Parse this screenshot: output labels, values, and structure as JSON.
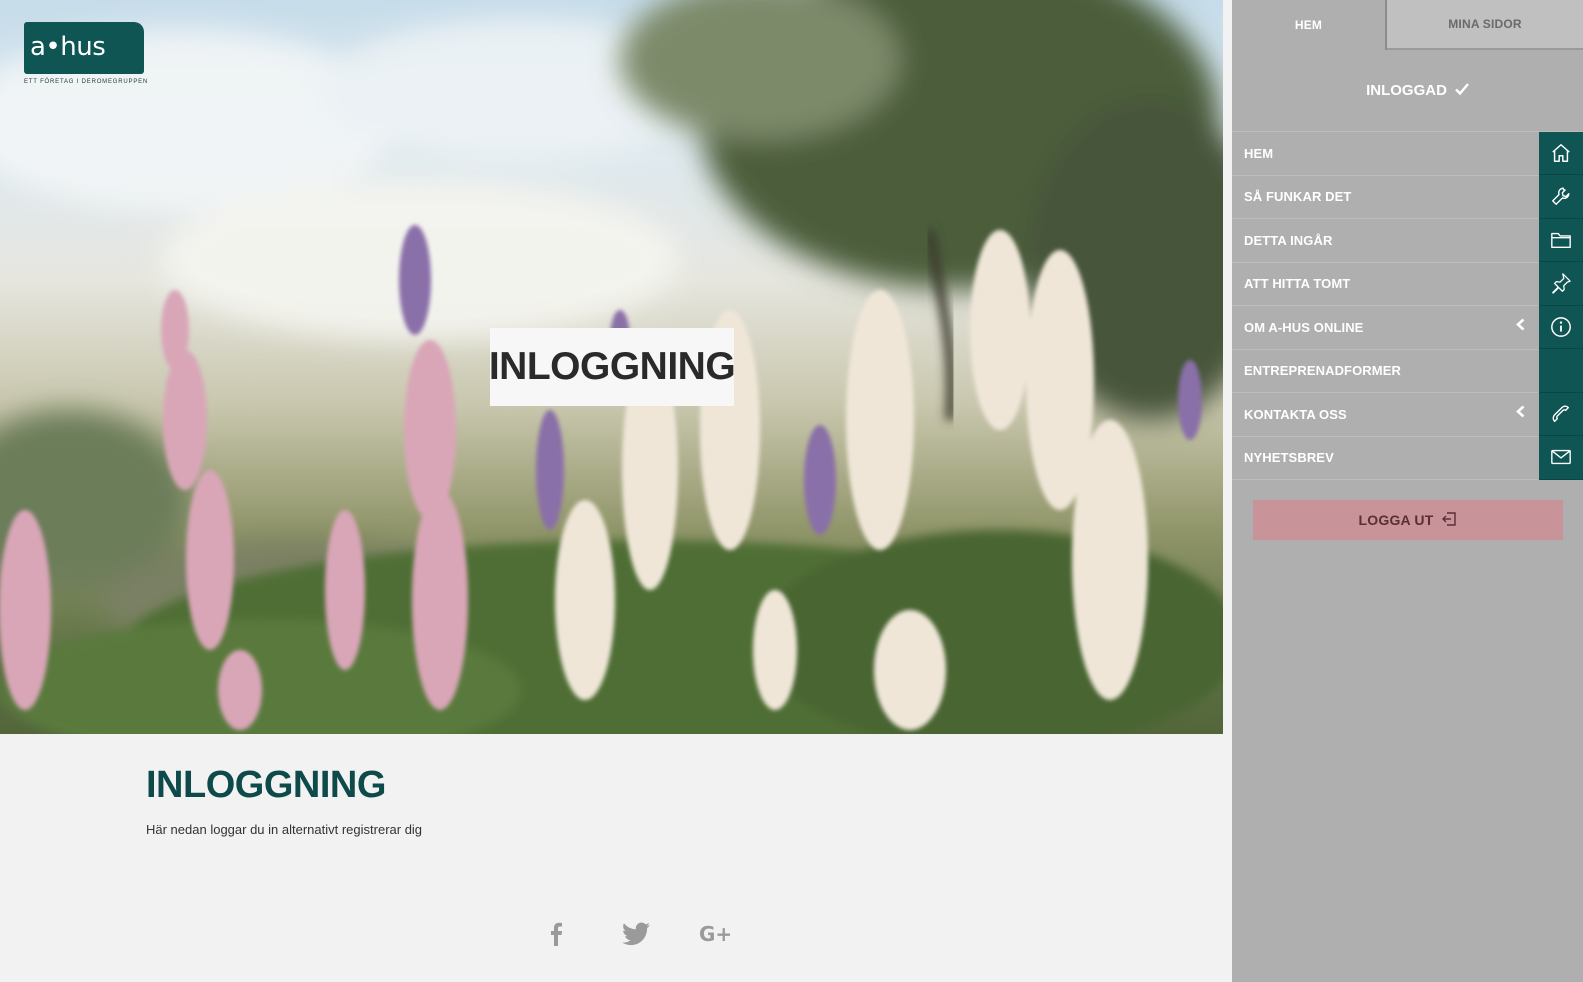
{
  "logo": {
    "text": "a•hus",
    "tagline": "ETT FÖRETAG I DEROMEGRUPPEN"
  },
  "hero": {
    "title": "INLOGGNING"
  },
  "content": {
    "title": "INLOGGNING",
    "subtitle": "Här nedan loggar du in alternativt registrerar dig",
    "social": [
      "facebook-icon",
      "twitter-icon",
      "google-plus-icon"
    ]
  },
  "sidebar": {
    "tabs": [
      {
        "label": "HEM",
        "active": true
      },
      {
        "label": "MINA SIDOR",
        "active": false
      }
    ],
    "status": "INLOGGAD",
    "items": [
      {
        "label": "HEM",
        "icon": "home-icon",
        "has_submenu": false
      },
      {
        "label": "SÅ FUNKAR DET",
        "icon": "wrench-icon",
        "has_submenu": false
      },
      {
        "label": "DETTA INGÅR",
        "icon": "folder-icon",
        "has_submenu": false
      },
      {
        "label": "ATT HITTA TOMT",
        "icon": "pin-icon",
        "has_submenu": false
      },
      {
        "label": "OM A-HUS ONLINE",
        "icon": "info-icon",
        "has_submenu": true
      },
      {
        "label": "ENTREPRENADFORMER",
        "icon": "",
        "has_submenu": false
      },
      {
        "label": "KONTAKTA OSS",
        "icon": "phone-icon",
        "has_submenu": true
      },
      {
        "label": "NYHETSBREV",
        "icon": "mail-icon",
        "has_submenu": false
      }
    ],
    "logout": "LOGGA UT"
  },
  "colors": {
    "brand_teal": "#0e5554",
    "sidebar_gray": "#afafaf",
    "logout_pink": "#c9939a",
    "page_bg": "#f2f2f2"
  }
}
